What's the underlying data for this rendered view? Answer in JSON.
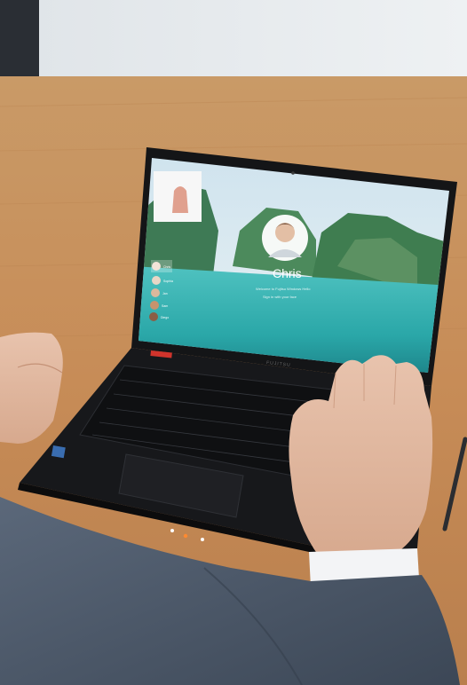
{
  "scene": {
    "description_kind": "photo",
    "login_screen": {
      "user_name": "Chris",
      "message_line_1": "Welcome to Fujitsu Windows Hello",
      "message_line_2": "Sign in with your face",
      "other_users": [
        "Chris",
        "Sophia",
        "Jan",
        "Sam",
        "Diego"
      ]
    },
    "laptop_brand": "FUJITSU",
    "colors": {
      "desk": "#c8915a",
      "wall": "#e6ebee",
      "laptop": "#151618",
      "suit": "#4d5a6a"
    }
  }
}
